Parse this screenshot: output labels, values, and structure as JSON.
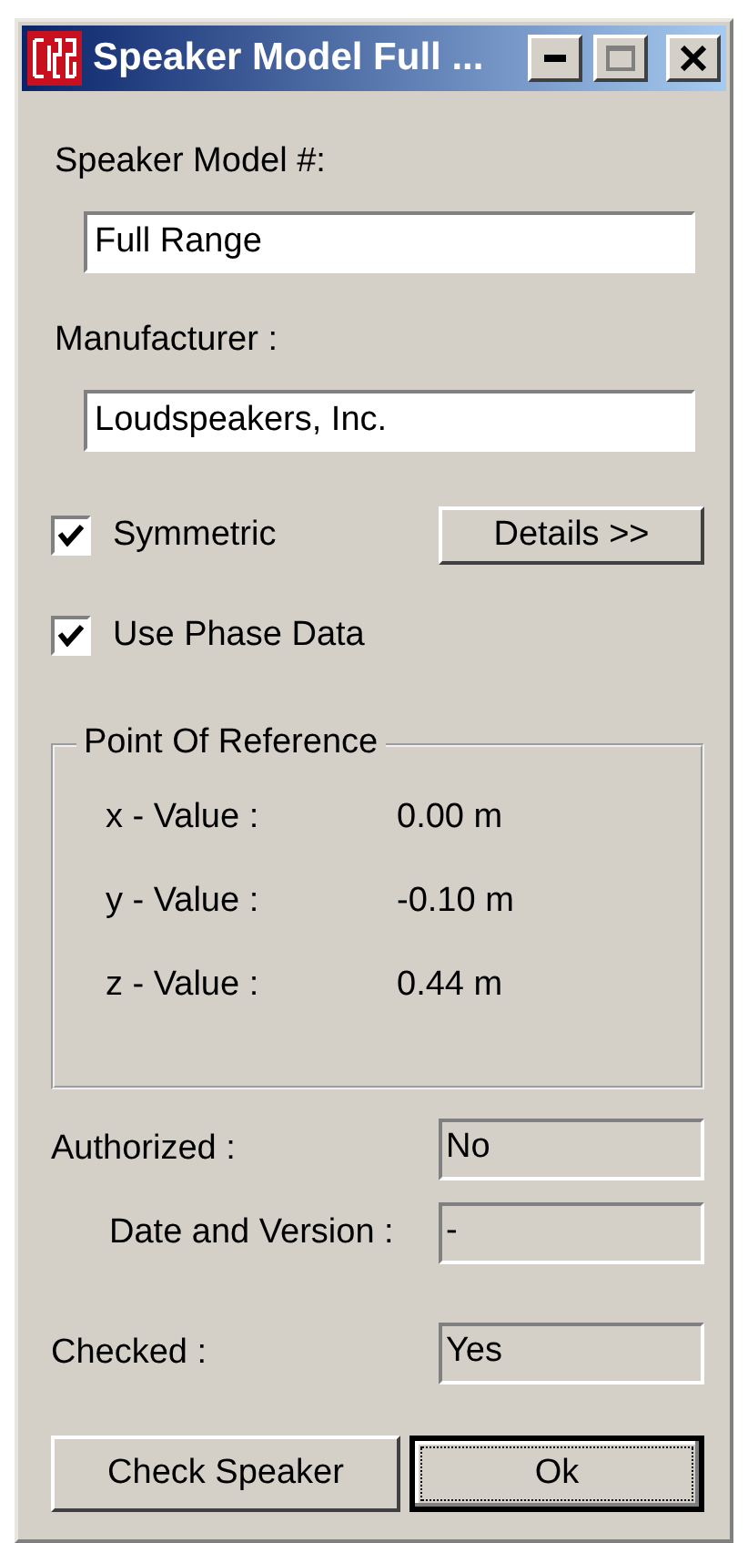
{
  "window": {
    "title": "Speaker Model Full ..."
  },
  "title_buttons": [
    {
      "kind": "minimize",
      "disabled": false
    },
    {
      "kind": "maximize",
      "disabled": true
    },
    {
      "kind": "close",
      "disabled": false
    }
  ],
  "speaker_model": {
    "label": "Speaker Model #:",
    "value": "Full Range"
  },
  "manufacturer": {
    "label": "Manufacturer :",
    "value": "Loudspeakers, Inc."
  },
  "symmetric": {
    "label": "Symmetric",
    "checked": true
  },
  "details_button": {
    "label": "Details >>"
  },
  "use_phase_data": {
    "label": "Use Phase Data",
    "checked": true
  },
  "point_of_reference": {
    "title": "Point Of Reference",
    "rows": [
      {
        "label": "x - Value :",
        "value": "0.00 m"
      },
      {
        "label": "y - Value :",
        "value": "-0.10 m"
      },
      {
        "label": "z - Value :",
        "value": "0.44 m"
      }
    ]
  },
  "status_fields": [
    {
      "label": "Authorized :",
      "value": "No"
    },
    {
      "label": "Date and Version :",
      "value": "-"
    },
    {
      "label": "Checked :",
      "value": "Yes"
    }
  ],
  "buttons": [
    {
      "label": "Check Speaker",
      "default": false
    },
    {
      "label": "Ok",
      "default": true
    }
  ]
}
